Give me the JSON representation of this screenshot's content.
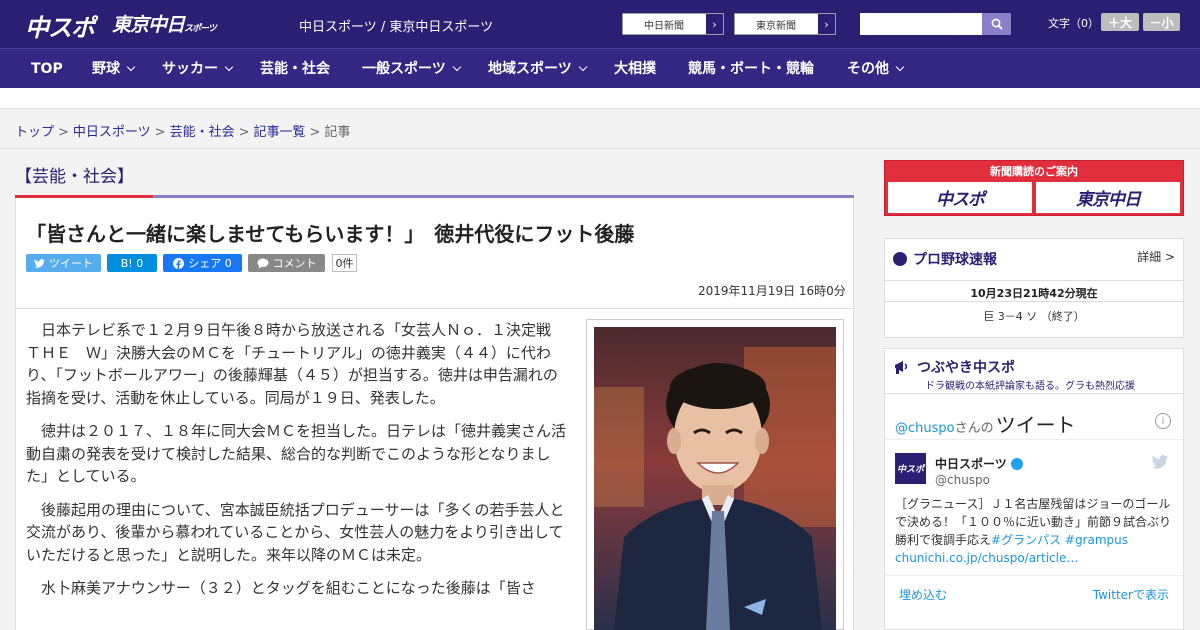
{
  "header": {
    "logo_chuspo": "中スポ",
    "logo_tokyo": "東京中日",
    "logo_tokyo_sub": "スポーツ",
    "site_title": "中日スポーツ / 東京中日スポーツ",
    "btn_chunichi": "中日新聞",
    "btn_tokyo": "東京新聞",
    "fontsize_label": "文字（0）",
    "fs_big": "＋大",
    "fs_small": "－小"
  },
  "nav": [
    {
      "label": "TOP",
      "dropdown": false
    },
    {
      "label": "野球",
      "dropdown": true
    },
    {
      "label": "サッカー",
      "dropdown": true
    },
    {
      "label": "芸能・社会",
      "dropdown": false
    },
    {
      "label": "一般スポーツ",
      "dropdown": true
    },
    {
      "label": "地域スポーツ",
      "dropdown": true
    },
    {
      "label": "大相撲",
      "dropdown": false
    },
    {
      "label": "競馬・ボート・競輪",
      "dropdown": false
    },
    {
      "label": "その他",
      "dropdown": true
    }
  ],
  "breadcrumb": {
    "top": "トップ",
    "chunichi": "中日スポーツ",
    "section": "芸能・社会",
    "list": "記事一覧",
    "current": "記事",
    "sep": ">"
  },
  "article": {
    "section_head": "【芸能・社会】",
    "title": "「皆さんと一緒に楽しませてもらいます！」　徳井代役にフット後藤",
    "share_tweet": "ツイート",
    "share_hatena": "B! 0",
    "share_facebook": "シェア 0",
    "share_comment": "コメント",
    "comment_count": "0件",
    "date": "2019年11月19日 16時0分",
    "paragraphs": [
      "日本テレビ系で１２月９日午後８時から放送される「女芸人Ｎｏ．１決定戦　ＴＨＥ　Ｗ」決勝大会のＭＣを「チュートリアル」の徳井義実（４４）に代わり、「フットボールアワー」の後藤輝基（４５）が担当する。徳井は申告漏れの指摘を受け、活動を休止している。同局が１９日、発表した。",
      "徳井は２０１７、１８年に同大会ＭＣを担当した。日テレは「徳井義実さん活動自粛の発表を受けて検討した結果、総合的な判断でこのような形となりました」としている。",
      "後藤起用の理由について、宮本誠臣統括プロデューサーは「多くの若手芸人と交流があり、後輩から慕われていることから、女性芸人の魅力をより引き出していただけると思った」と説明した。来年以降のＭＣは未定。",
      "水卜麻美アナウンサー（３２）とタッグを組むことになった後藤は「皆さ"
    ]
  },
  "sidebar": {
    "subscribe_title": "新聞購読のご案内",
    "subscribe_chuspo": "中スポ",
    "subscribe_tokyo": "東京中日",
    "baseball_head": "プロ野球速報",
    "baseball_detail": "詳細 >",
    "baseball_time": "10月23日21時42分現在",
    "baseball_score": "巨 3－4 ソ （終了）",
    "tw_head": "つぶやき中スポ",
    "tw_sub": "ドラ観戦の本紙評論家も語る。グラも熱烈応援",
    "tw_handle_link": "@chuspo",
    "tw_handle_suffix": "さんの",
    "tw_word": "ツイート",
    "tw_info": "i",
    "tw_avatar": "中スポ",
    "tw_name": "中日スポーツ",
    "tw_user": "@chuspo",
    "tw_text_main": "［グラニュース］Ｊ１名古屋残留はジョーのゴールで決める！「１００％に近い動き」前節９試合ぶり勝利で復調手応え",
    "tw_text_tag": "#グランパス #grampus",
    "tw_text_link": "chunichi.co.jp/chuspo/article…",
    "tw_embed": "埋め込む",
    "tw_view": "Twitterで表示"
  },
  "colors": {
    "brand": "#2a1f72",
    "nav": "#332783",
    "accent_red": "#e02e3c",
    "twitter_blue": "#1b95e0"
  }
}
